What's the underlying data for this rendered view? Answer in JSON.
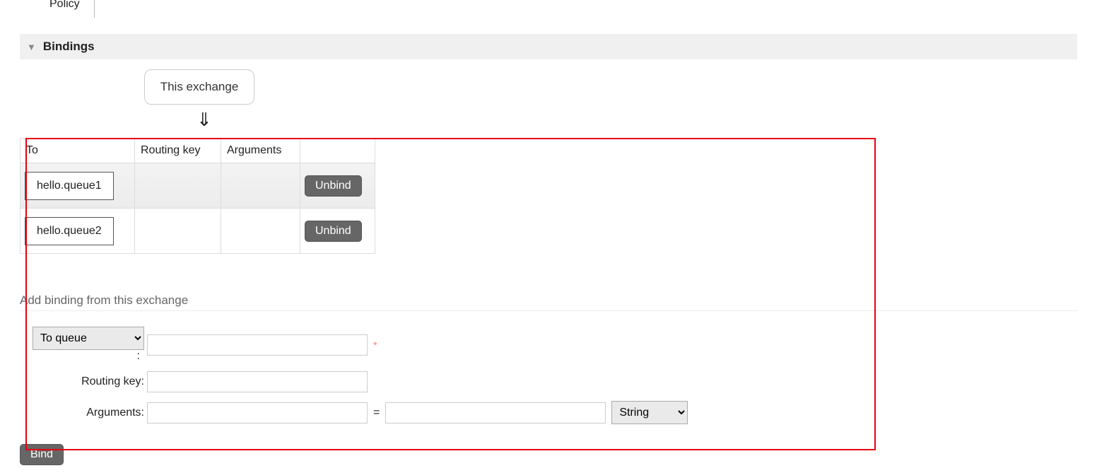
{
  "policy_label": "Policy",
  "section": {
    "title": "Bindings"
  },
  "exchange_box_label": "This exchange",
  "bindings_table": {
    "headers": {
      "to": "To",
      "routing_key": "Routing key",
      "arguments": "Arguments"
    },
    "rows": [
      {
        "to": "hello.queue1",
        "routing_key": "",
        "arguments": "",
        "action_label": "Unbind"
      },
      {
        "to": "hello.queue2",
        "routing_key": "",
        "arguments": "",
        "action_label": "Unbind"
      }
    ]
  },
  "add_binding": {
    "heading": "Add binding from this exchange",
    "to_select_value": "To queue",
    "to_input_value": "",
    "routing_key_label": "Routing key:",
    "routing_key_value": "",
    "arguments_label": "Arguments:",
    "arg_key_value": "",
    "arg_val_value": "",
    "arg_type_value": "String",
    "bind_button_label": "Bind"
  }
}
